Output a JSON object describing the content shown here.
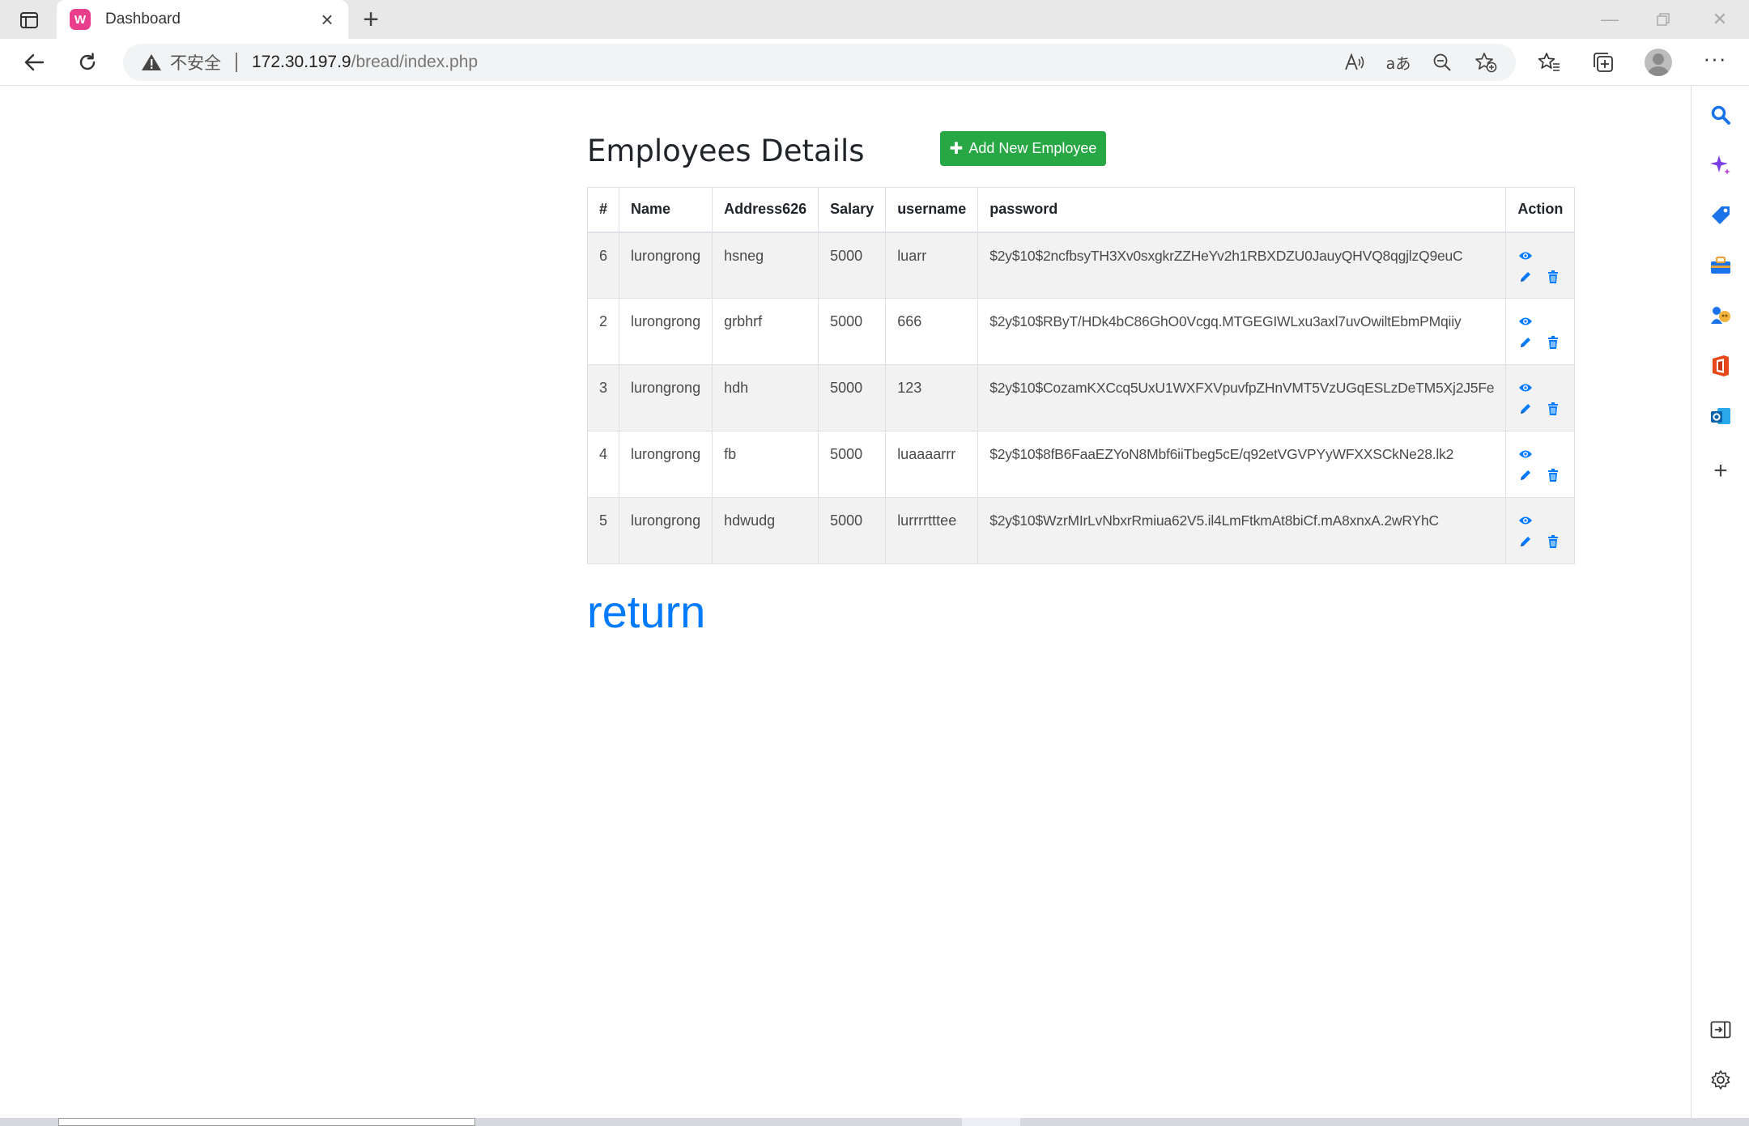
{
  "browser": {
    "tab_title": "Dashboard",
    "favicon_letter": "W",
    "insecure_label": "不安全",
    "url_host": "172.30.197.9",
    "url_path": "/bread/index.php"
  },
  "page": {
    "heading": "Employees Details",
    "add_button": "Add New Employee",
    "return_link": "return"
  },
  "table": {
    "headers": {
      "id": "#",
      "name": "Name",
      "address": "Address626",
      "salary": "Salary",
      "username": "username",
      "password": "password",
      "action": "Action"
    },
    "rows": [
      {
        "id": "6",
        "name": "lurongrong",
        "address": "hsneg",
        "salary": "5000",
        "username": "luarr",
        "password": "$2y$10$2ncfbsyTH3Xv0sxgkrZZHeYv2h1RBXDZU0JauyQHVQ8qgjlzQ9euC"
      },
      {
        "id": "2",
        "name": "lurongrong",
        "address": "grbhrf",
        "salary": "5000",
        "username": "666",
        "password": "$2y$10$RByT/HDk4bC86GhO0Vcgq.MTGEGIWLxu3axl7uvOwiltEbmPMqiiy"
      },
      {
        "id": "3",
        "name": "lurongrong",
        "address": "hdh",
        "salary": "5000",
        "username": "123",
        "password": "$2y$10$CozamKXCcq5UxU1WXFXVpuvfpZHnVMT5VzUGqESLzDeTM5Xj2J5Fe"
      },
      {
        "id": "4",
        "name": "lurongrong",
        "address": "fb",
        "salary": "5000",
        "username": "luaaaarrr",
        "password": "$2y$10$8fB6FaaEZYoN8Mbf6iiTbeg5cE/q92etVGVPYyWFXXSCkNe28.lk2"
      },
      {
        "id": "5",
        "name": "lurongrong",
        "address": "hdwudg",
        "salary": "5000",
        "username": "lurrrrtttee",
        "password": "$2y$10$WzrMIrLvNbxrRmiua62V5.il4LmFtkmAt8biCf.mA8xnxA.2wRYhC"
      }
    ]
  },
  "colors": {
    "accent": "#007bff",
    "success": "#28a745",
    "stripe": "#f2f2f2"
  },
  "icons": [
    "layout-icon",
    "back-icon",
    "refresh-icon",
    "warning-icon",
    "read-aloud-icon",
    "translate-icon",
    "zoom-out-icon",
    "favorite-add-icon",
    "favorites-icon",
    "collections-icon",
    "more-icon",
    "eye-icon",
    "pencil-icon",
    "trash-icon"
  ]
}
